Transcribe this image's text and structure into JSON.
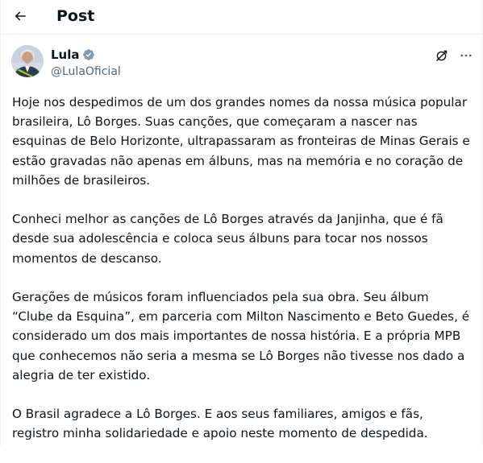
{
  "header": {
    "back_icon": "arrow-left-icon",
    "title": "Post"
  },
  "author": {
    "display_name": "Lula",
    "handle": "@LulaOficial",
    "verified_icon": "verified-badge-icon",
    "verified_color": "#829aab",
    "avatar_icon": "avatar-image"
  },
  "actions": {
    "grok_icon": "grok-icon",
    "more_icon": "more-options-icon"
  },
  "post": {
    "paragraphs": [
      "Hoje nos despedimos de um dos grandes nomes da nossa música popular brasileira, Lô Borges. Suas canções, que começaram a nascer nas esquinas de Belo Horizonte, ultrapassaram as fronteiras de Minas Gerais e estão gravadas não apenas em álbuns, mas na memória e no coração de milhões de brasileiros.",
      "Conheci melhor as canções de Lô Borges através da Janjinha, que é fã desde sua adolescência e coloca seus álbuns para tocar nos nossos momentos de descanso.",
      "Gerações de músicos foram influenciados pela sua obra. Seu álbum “Clube da Esquina”, em parceria com Milton Nascimento e Beto Guedes, é considerado um dos mais importantes de nossa história. E a própria MPB que conhecemos não seria a mesma se Lô Borges não tivesse nos dado a alegria de ter existido.",
      "O Brasil agradece a Lô Borges. E aos seus familiares, amigos e fãs, registro minha solidariedade e apoio neste momento de despedida."
    ]
  },
  "colors": {
    "text": "#0f1419",
    "secondary_text": "#536471",
    "divider": "#eff3f4"
  }
}
